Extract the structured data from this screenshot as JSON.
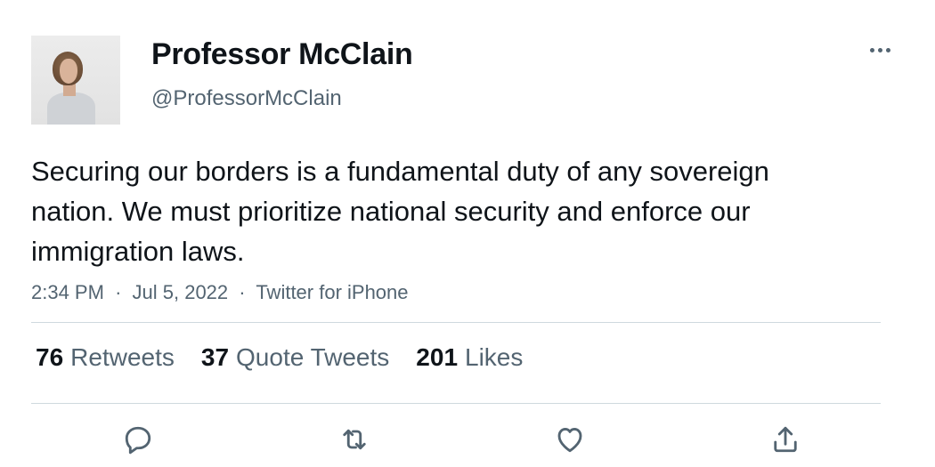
{
  "author": {
    "name": "Professor McClain",
    "handle": "@ProfessorMcClain"
  },
  "tweet": {
    "text": "Securing our borders is a fundamental duty of any sovereign nation. We must prioritize national security and enforce our immigration laws.",
    "time": "2:34 PM",
    "date": "Jul 5, 2022",
    "source": "Twitter for iPhone",
    "separator": "·"
  },
  "stats": {
    "retweets": {
      "count": "76",
      "label": "Retweets"
    },
    "quotes": {
      "count": "37",
      "label": "Quote Tweets"
    },
    "likes": {
      "count": "201",
      "label": "Likes"
    }
  },
  "actions": [
    "reply-icon",
    "retweet-icon",
    "like-icon",
    "share-icon"
  ],
  "colors": {
    "text": "#0f1419",
    "secondary": "#536471",
    "divider": "#cfd9de"
  }
}
